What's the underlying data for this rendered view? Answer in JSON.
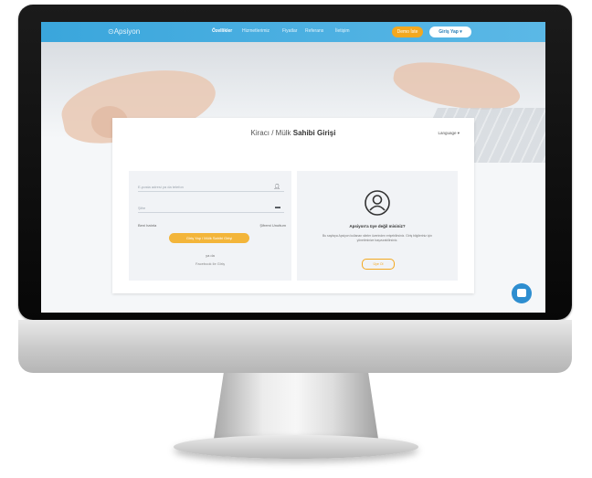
{
  "navbar": {
    "brand": "Apsiyon",
    "items": [
      "Özellikler",
      "Hizmetlerimiz",
      "Fiyatlar",
      "Referans",
      "İletişim"
    ],
    "demo_button": "Demo İste",
    "login_button": "Giriş Yap ▾"
  },
  "card": {
    "title_prefix": "Kiracı / Mülk ",
    "title_bold": "Sahibi Girişi",
    "language": "Language ▾",
    "left": {
      "username_placeholder": "E-posta adresi ya da telefon",
      "password_placeholder": "Şifre",
      "remember": "Beni hatırla",
      "forgot": "Şifremi Unuttum",
      "login_button": "Giriş Yap / Mülk Sahibi Girişi",
      "or": "ya da",
      "alt_login": "Facebook ile Giriş"
    },
    "right": {
      "title": "Apsiyon'a üye değil misiniz?",
      "text": "Bu sayfaya Apsiyon kullanan siteler üzerinden erişebilirsiniz. Giriş bilgileriniz için yönetiminize başvurabilirsiniz.",
      "signup_button": "Üye Ol"
    }
  },
  "colors": {
    "nav_blue": "#3aa6dc",
    "accent_orange": "#f3a81f"
  }
}
